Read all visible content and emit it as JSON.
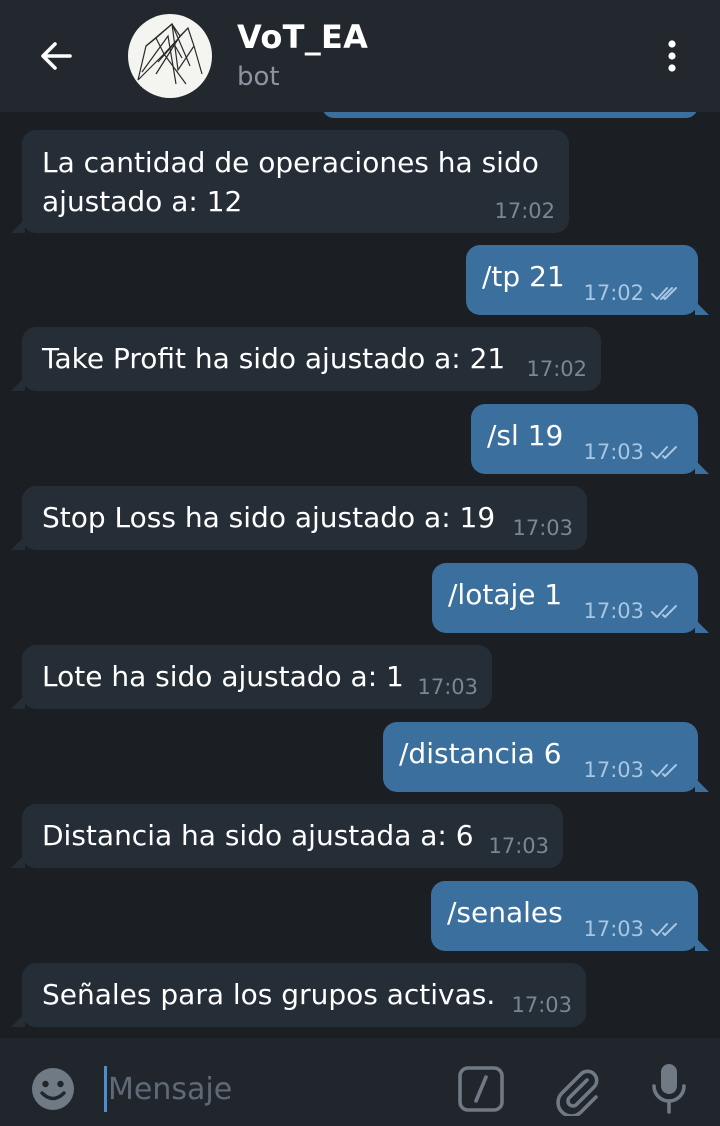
{
  "header": {
    "title": "VoT_EA",
    "subtitle": "bot",
    "back_icon": "arrow-left-icon",
    "menu_icon": "more-vertical-icon"
  },
  "messages": [
    {
      "direction": "in",
      "lines": [
        "La cantidad de operaciones ha sido",
        "ajustado a: 12"
      ],
      "time": "17:02"
    },
    {
      "direction": "out",
      "text": "/tp 21",
      "time": "17:02",
      "status": "read"
    },
    {
      "direction": "in",
      "text": "Take Profit ha sido ajustado a: 21",
      "time": "17:02"
    },
    {
      "direction": "out",
      "text": "/sl 19",
      "time": "17:03",
      "status": "read"
    },
    {
      "direction": "in",
      "text": "Stop Loss ha sido ajustado a: 19",
      "time": "17:03"
    },
    {
      "direction": "out",
      "text": "/lotaje 1",
      "time": "17:03",
      "status": "read"
    },
    {
      "direction": "in",
      "text": "Lote ha sido ajustado a: 1",
      "time": "17:03"
    },
    {
      "direction": "out",
      "text": "/distancia 6",
      "time": "17:03",
      "status": "read"
    },
    {
      "direction": "in",
      "text": "Distancia ha sido ajustada a: 6",
      "time": "17:03"
    },
    {
      "direction": "out",
      "text": "/senales",
      "time": "17:03",
      "status": "read"
    },
    {
      "direction": "in",
      "text": "Señales para los grupos activas.",
      "time": "17:03"
    }
  ],
  "input": {
    "placeholder": "Mensaje",
    "value": ""
  },
  "colors": {
    "background": "#1b1f23",
    "header": "#22282e",
    "incoming_bubble": "#252d37",
    "outgoing_bubble": "#3a6f9e",
    "accent": "#4c8fcf"
  },
  "icons": {
    "emoji": "smile-icon",
    "commands": "slash-command-icon",
    "attach": "paperclip-icon",
    "voice": "microphone-icon",
    "read_status": "double-check-icon"
  }
}
